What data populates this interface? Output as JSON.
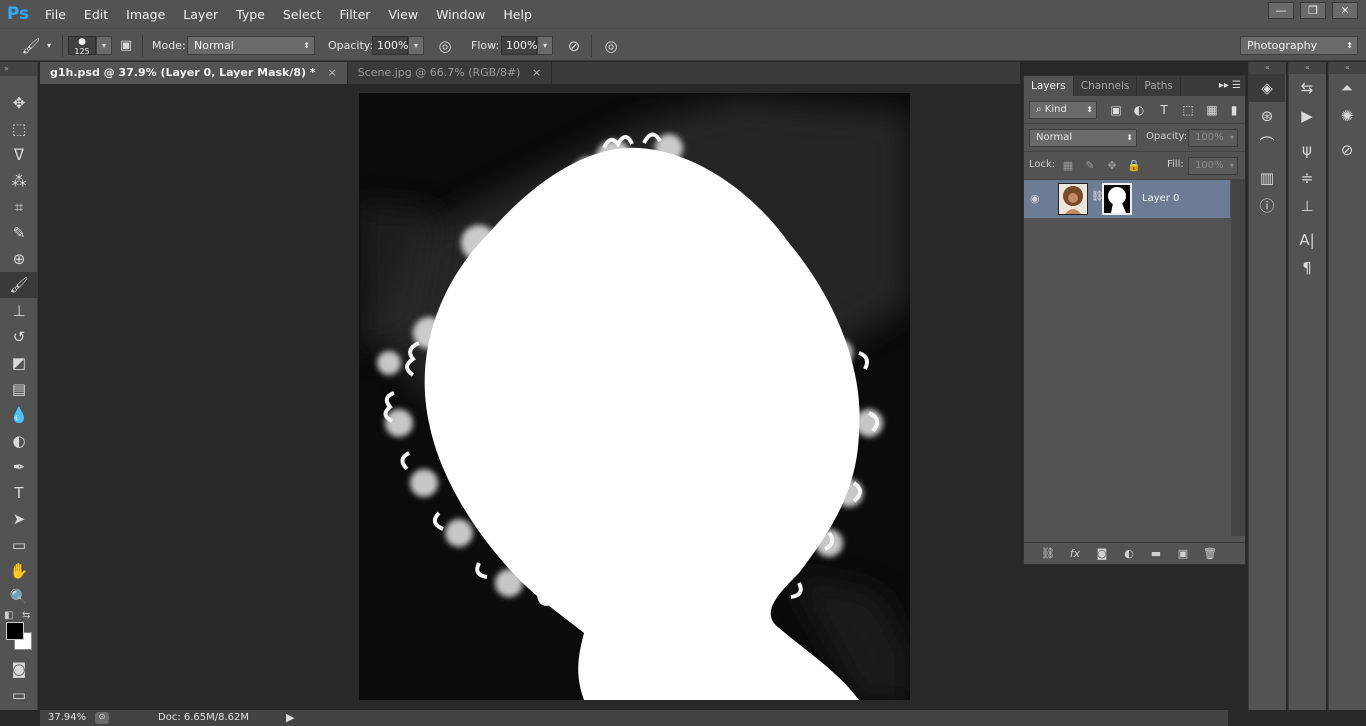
{
  "app": {
    "logo": "Ps",
    "menu": [
      "File",
      "Edit",
      "Image",
      "Layer",
      "Type",
      "Select",
      "Filter",
      "View",
      "Window",
      "Help"
    ],
    "window_controls": [
      "—",
      "❐",
      "✕"
    ]
  },
  "options_bar": {
    "brush_size": "125",
    "mode_label": "Mode:",
    "mode_value": "Normal",
    "opacity_label": "Opacity:",
    "opacity_value": "100%",
    "flow_label": "Flow:",
    "flow_value": "100%",
    "workspace": "Photography"
  },
  "tabs": [
    {
      "label": "g1h.psd @ 37.9% (Layer 0, Layer Mask/8) *",
      "close": "×",
      "active": true
    },
    {
      "label": "Scene.jpg @ 66.7% (RGB/8#)",
      "close": "×",
      "active": false
    }
  ],
  "tools": [
    "move-icon",
    "marquee-icon",
    "lasso-icon",
    "magic-wand-icon",
    "crop-icon",
    "eyedropper-icon",
    "spot-healing-icon",
    "brush-icon",
    "clone-stamp-icon",
    "history-brush-icon",
    "eraser-icon",
    "gradient-icon",
    "blur-icon",
    "dodge-icon",
    "pen-icon",
    "type-icon",
    "path-selection-icon",
    "rectangle-icon",
    "hand-icon",
    "zoom-icon"
  ],
  "colors": {
    "foreground": "#000000",
    "background": "#ffffff",
    "selected_layer": "#6c7c94",
    "panel_bg": "#535353"
  },
  "status": {
    "zoom": "37.94%",
    "doc": "Doc: 6.65M/8.62M"
  },
  "layers_panel": {
    "tabs": [
      "Layers",
      "Channels",
      "Paths"
    ],
    "filter_kind": "Kind",
    "blend_mode": "Normal",
    "opacity_label": "Opacity:",
    "opacity_value": "100%",
    "lock_label": "Lock:",
    "fill_label": "Fill:",
    "fill_value": "100%",
    "layer_name": "Layer 0",
    "bottom_icons": [
      "link-icon",
      "fx-icon",
      "add-mask-icon",
      "adjustment-icon",
      "folder-icon",
      "new-layer-icon",
      "trash-icon"
    ]
  }
}
